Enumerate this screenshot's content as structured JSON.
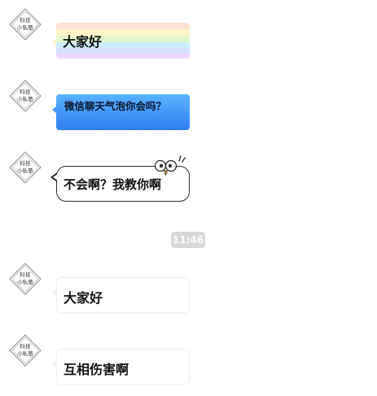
{
  "avatar": {
    "line1": "科技",
    "line2": "小私塾"
  },
  "messages": [
    {
      "style": "rainbow",
      "text": "大家好"
    },
    {
      "style": "blue",
      "text": "微信聊天气泡你会吗？"
    },
    {
      "style": "cartoon",
      "text": "不会啊？我教你啊"
    },
    {
      "style": "plain",
      "text": "大家好"
    },
    {
      "style": "plain",
      "text": "互相伤害啊"
    }
  ],
  "timestamp": "11:46",
  "colors": {
    "blue_bubble_top": "#5ab2ff",
    "blue_bubble_bottom": "#2f7ef0",
    "time_pill": "#d8d8d8"
  }
}
